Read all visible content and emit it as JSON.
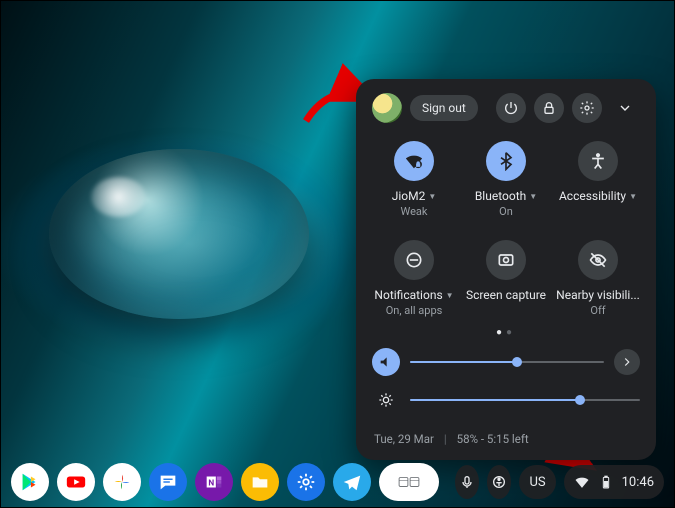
{
  "panel": {
    "sign_out": "Sign out",
    "tiles": [
      {
        "label": "JioM2",
        "sub": "Weak",
        "on": true,
        "caret": true
      },
      {
        "label": "Bluetooth",
        "sub": "On",
        "on": true,
        "caret": true
      },
      {
        "label": "Accessibility",
        "sub": "",
        "on": false,
        "caret": true
      },
      {
        "label": "Notifications",
        "sub": "On, all apps",
        "on": false,
        "caret": true
      },
      {
        "label": "Screen capture",
        "sub": "",
        "on": false,
        "caret": false
      },
      {
        "label": "Nearby visibili...",
        "sub": "Off",
        "on": false,
        "caret": false
      }
    ],
    "volume_percent": 55,
    "brightness_percent": 74,
    "date": "Tue, 29 Mar",
    "battery": "58% - 5:15 left"
  },
  "shelf": {
    "ime": "US",
    "clock": "10:46"
  }
}
